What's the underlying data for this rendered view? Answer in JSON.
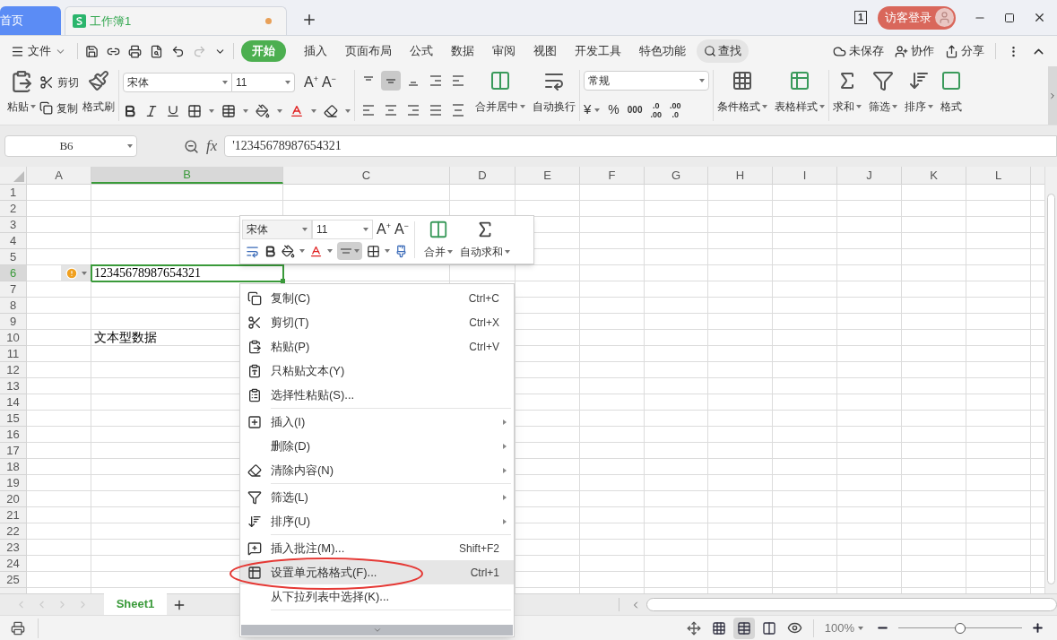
{
  "title_bar": {
    "tabs": [
      {
        "label": "首页",
        "kind": "home",
        "selected": false,
        "unsaved": false
      },
      {
        "label": "工作簿1",
        "kind": "document",
        "selected": true,
        "unsaved": true
      }
    ],
    "window_count": "1",
    "login": "访客登录"
  },
  "menu_bar": {
    "file": "文件",
    "tabs": [
      {
        "label": "开始",
        "selected": true
      },
      {
        "label": "插入",
        "selected": false
      },
      {
        "label": "页面布局",
        "selected": false
      },
      {
        "label": "公式",
        "selected": false
      },
      {
        "label": "数据",
        "selected": false
      },
      {
        "label": "审阅",
        "selected": false
      },
      {
        "label": "视图",
        "selected": false
      },
      {
        "label": "开发工具",
        "selected": false
      },
      {
        "label": "特色功能",
        "selected": false
      }
    ],
    "search": "查找",
    "actions": [
      "未保存",
      "协作",
      "分享"
    ]
  },
  "ribbon": {
    "paste": "粘贴",
    "cut": "剪切",
    "copy": "复制",
    "format_painter": "格式刷",
    "font_family": "宋体",
    "font_size": "11",
    "vertical_align": [
      {
        "selected": false
      },
      {
        "selected": true
      },
      {
        "selected": false
      }
    ],
    "grow_font": {
      "letter": "A",
      "sign": "+"
    },
    "shrink_font": {
      "letter": "A",
      "sign": "−"
    },
    "merge": "合并居中",
    "wrap": "自动换行",
    "number_format": "常规",
    "currency": "¥",
    "percent": "%",
    "thousands": "000",
    "decimals": [
      {
        "top": ".0",
        "bottom": ".00"
      },
      {
        "top": ".00",
        "bottom": ".0"
      }
    ],
    "conditional_format": "条件格式",
    "table_style": "表格样式",
    "sum": "求和",
    "filter": "筛选",
    "sort": "排序",
    "format": "格式"
  },
  "formula_bar": {
    "name_box": "B6",
    "function_label": "fx",
    "formula": "'12345678987654321"
  },
  "sheet": {
    "columns": [
      {
        "label": "A",
        "selected": false
      },
      {
        "label": "B",
        "selected": true
      },
      {
        "label": "C",
        "selected": false
      },
      {
        "label": "D",
        "selected": false
      },
      {
        "label": "E",
        "selected": false
      },
      {
        "label": "F",
        "selected": false
      },
      {
        "label": "G",
        "selected": false
      },
      {
        "label": "H",
        "selected": false
      },
      {
        "label": "I",
        "selected": false
      },
      {
        "label": "J",
        "selected": false
      },
      {
        "label": "K",
        "selected": false
      },
      {
        "label": "L",
        "selected": false
      }
    ],
    "rows": [
      {
        "label": "1",
        "selected": false,
        "error_flag": false
      },
      {
        "label": "2",
        "selected": false,
        "error_flag": false
      },
      {
        "label": "3",
        "selected": false,
        "error_flag": false
      },
      {
        "label": "4",
        "selected": false,
        "error_flag": false
      },
      {
        "label": "5",
        "selected": false,
        "error_flag": false
      },
      {
        "label": "6",
        "selected": true,
        "error_flag": true,
        "values": {
          "B": "12345678987654321"
        }
      },
      {
        "label": "7",
        "selected": false,
        "error_flag": false
      },
      {
        "label": "8",
        "selected": false,
        "error_flag": false
      },
      {
        "label": "9",
        "selected": false,
        "error_flag": false
      },
      {
        "label": "10",
        "selected": false,
        "error_flag": false,
        "values": {
          "B": "文本型数据"
        }
      },
      {
        "label": "11",
        "selected": false,
        "error_flag": false
      },
      {
        "label": "12",
        "selected": false,
        "error_flag": false
      },
      {
        "label": "13",
        "selected": false,
        "error_flag": false
      },
      {
        "label": "14",
        "selected": false,
        "error_flag": false
      },
      {
        "label": "15",
        "selected": false,
        "error_flag": false
      },
      {
        "label": "16",
        "selected": false,
        "error_flag": false
      },
      {
        "label": "17",
        "selected": false,
        "error_flag": false
      },
      {
        "label": "18",
        "selected": false,
        "error_flag": false
      },
      {
        "label": "19",
        "selected": false,
        "error_flag": false
      },
      {
        "label": "20",
        "selected": false,
        "error_flag": false
      },
      {
        "label": "21",
        "selected": false,
        "error_flag": false
      },
      {
        "label": "22",
        "selected": false,
        "error_flag": false
      },
      {
        "label": "23",
        "selected": false,
        "error_flag": false
      },
      {
        "label": "24",
        "selected": false,
        "error_flag": false
      },
      {
        "label": "25",
        "selected": false,
        "error_flag": false
      }
    ]
  },
  "mini_toolbar": {
    "font_family": "宋体",
    "font_size": "11",
    "grow_font": {
      "letter": "A",
      "sign": "+"
    },
    "shrink_font": {
      "letter": "A",
      "sign": "−"
    },
    "align_selected": true,
    "merge": "合并",
    "autosum": "自动求和"
  },
  "context_menu": [
    {
      "kind": "item",
      "label": "复制(C)",
      "shortcut": "Ctrl+C",
      "submenu": false,
      "selected": false
    },
    {
      "kind": "item",
      "label": "剪切(T)",
      "shortcut": "Ctrl+X",
      "submenu": false,
      "selected": false
    },
    {
      "kind": "item",
      "label": "粘贴(P)",
      "shortcut": "Ctrl+V",
      "submenu": false,
      "selected": false
    },
    {
      "kind": "item",
      "label": "只粘贴文本(Y)",
      "submenu": false,
      "selected": false
    },
    {
      "kind": "item",
      "label": "选择性粘贴(S)...",
      "submenu": false,
      "selected": false
    },
    {
      "kind": "separator"
    },
    {
      "kind": "item",
      "label": "插入(I)",
      "submenu": true,
      "selected": false
    },
    {
      "kind": "item",
      "label": "删除(D)",
      "submenu": true,
      "selected": false
    },
    {
      "kind": "item",
      "label": "清除内容(N)",
      "submenu": true,
      "selected": false
    },
    {
      "kind": "separator"
    },
    {
      "kind": "item",
      "label": "筛选(L)",
      "submenu": true,
      "selected": false
    },
    {
      "kind": "item",
      "label": "排序(U)",
      "submenu": true,
      "selected": false
    },
    {
      "kind": "separator"
    },
    {
      "kind": "item",
      "label": "插入批注(M)...",
      "shortcut": "Shift+F2",
      "submenu": false,
      "selected": false
    },
    {
      "kind": "item",
      "label": "设置单元格格式(F)...",
      "shortcut": "Ctrl+1",
      "submenu": false,
      "selected": true
    },
    {
      "kind": "item",
      "label": "从下拉列表中选择(K)...",
      "submenu": false,
      "selected": false
    },
    {
      "kind": "separator"
    }
  ],
  "sheet_tabs": [
    {
      "label": "Sheet1",
      "selected": true
    }
  ],
  "status_bar": {
    "views": [
      {
        "selected": false
      },
      {
        "selected": true
      },
      {
        "selected": false
      }
    ],
    "zoom": "100%",
    "zoom_slider": {
      "level": 0.5
    }
  }
}
